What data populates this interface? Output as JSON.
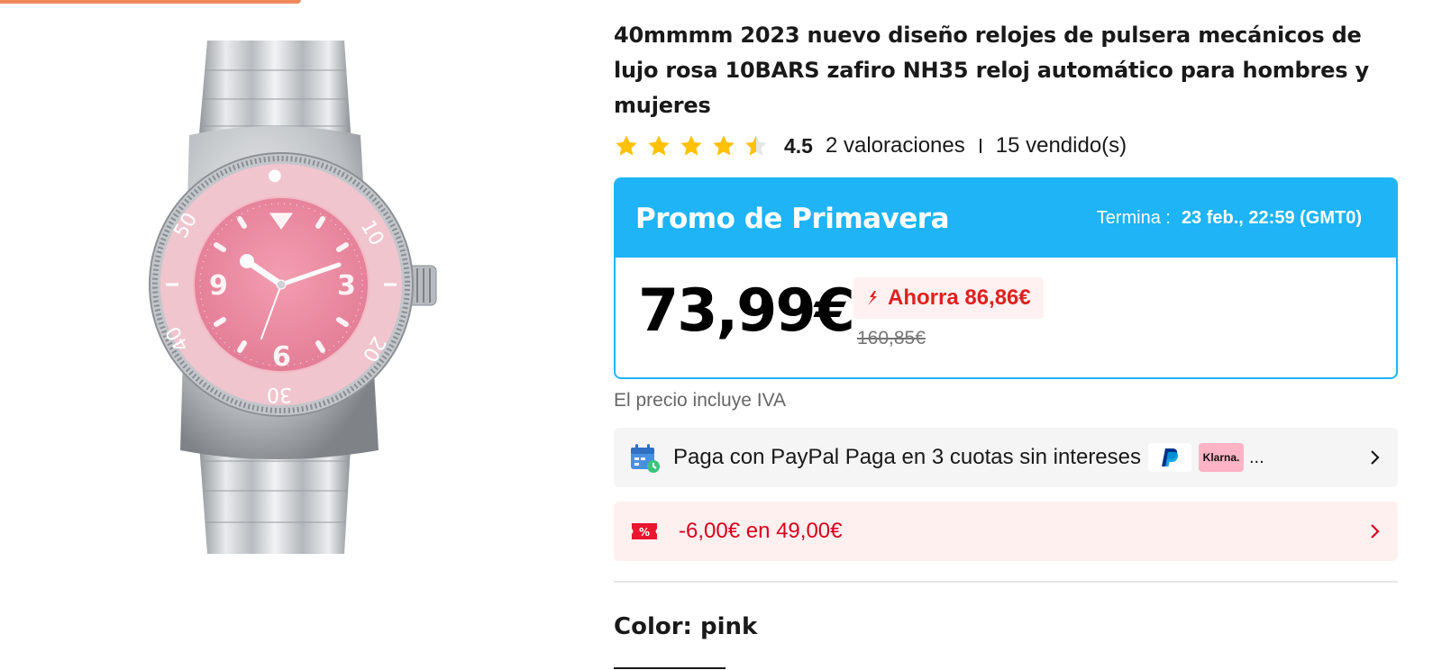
{
  "product": {
    "title": "40mmmm 2023 nuevo diseño relojes de pulsera mecánicos de lujo rosa 10BARS zafiro NH35 reloj automático para hombres y mujeres",
    "image_alt": "pink-dial-steel-watch"
  },
  "rating": {
    "value": "4.5",
    "stars": 4.5,
    "reviews": "2 valoraciones",
    "sold": "15 vendido(s)",
    "star_color": "#ffc107"
  },
  "promo": {
    "title": "Promo de Primavera",
    "ends_label": "Termina :",
    "ends_date": "23 feb., 22:59 (GMT0)",
    "accent_color": "#1eb4f5",
    "price": "73,99€",
    "save": "Ahorra 86,86€",
    "old_price": "160,85€"
  },
  "vat_note": "El precio incluye IVA",
  "payment": {
    "icon": "calendar-card-icon",
    "text": "Paga con PayPal Paga en 3 cuotas sin intereses",
    "badges": [
      "paypal",
      "Klarna."
    ],
    "more": "..."
  },
  "coupon": {
    "icon": "percent-ticket-icon",
    "text": "-6,00€ en 49,00€",
    "color": "#d8001e"
  },
  "color_option": {
    "label": "Color: pink"
  }
}
